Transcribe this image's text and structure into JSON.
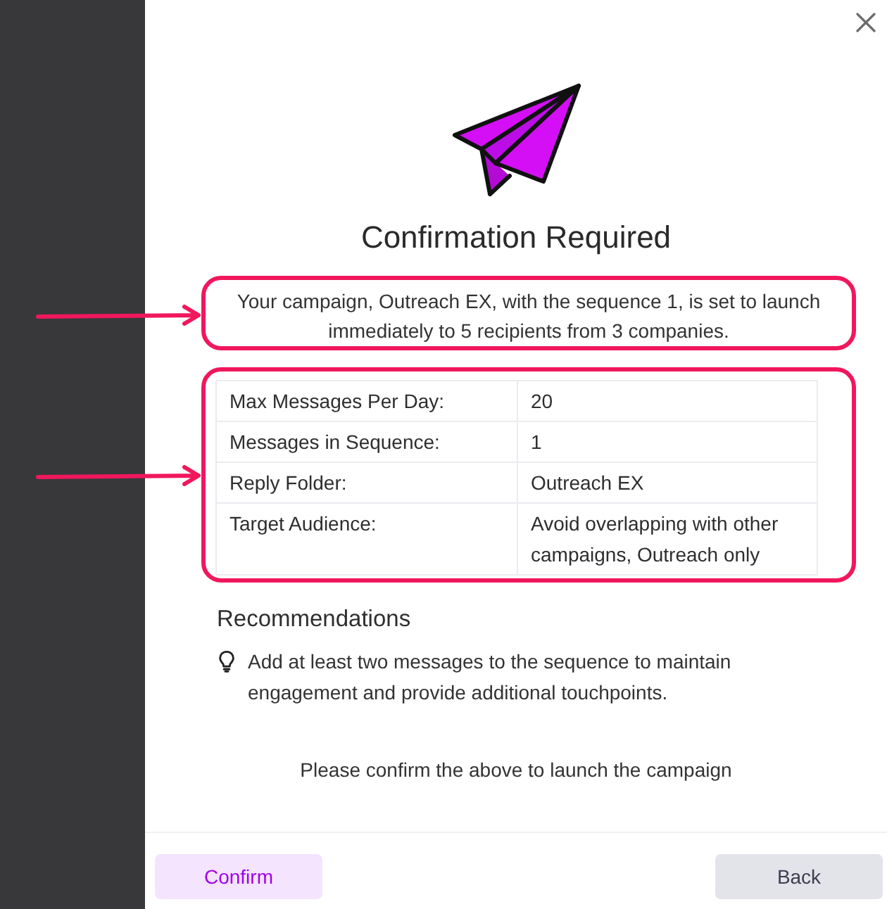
{
  "dialog": {
    "title": "Confirmation Required",
    "summary": "Your campaign, Outreach EX, with the sequence 1, is set to launch immediately to 5 recipients from 3 companies.",
    "details": [
      {
        "label": "Max Messages Per Day:",
        "value": "20"
      },
      {
        "label": "Messages in Sequence:",
        "value": "1"
      },
      {
        "label": "Reply Folder:",
        "value": "Outreach EX"
      },
      {
        "label": "Target Audience:",
        "value": "Avoid overlapping with other campaigns, Outreach only"
      }
    ],
    "recommendations": {
      "heading": "Recommendations",
      "items": [
        "Add at least two messages to the sequence to maintain engagement and provide additional touchpoints."
      ]
    },
    "prompt": "Please confirm the above to launch the campaign",
    "buttons": [
      {
        "label": "Confirm",
        "kind": "primary"
      },
      {
        "label": "Back",
        "kind": "secondary"
      }
    ]
  }
}
